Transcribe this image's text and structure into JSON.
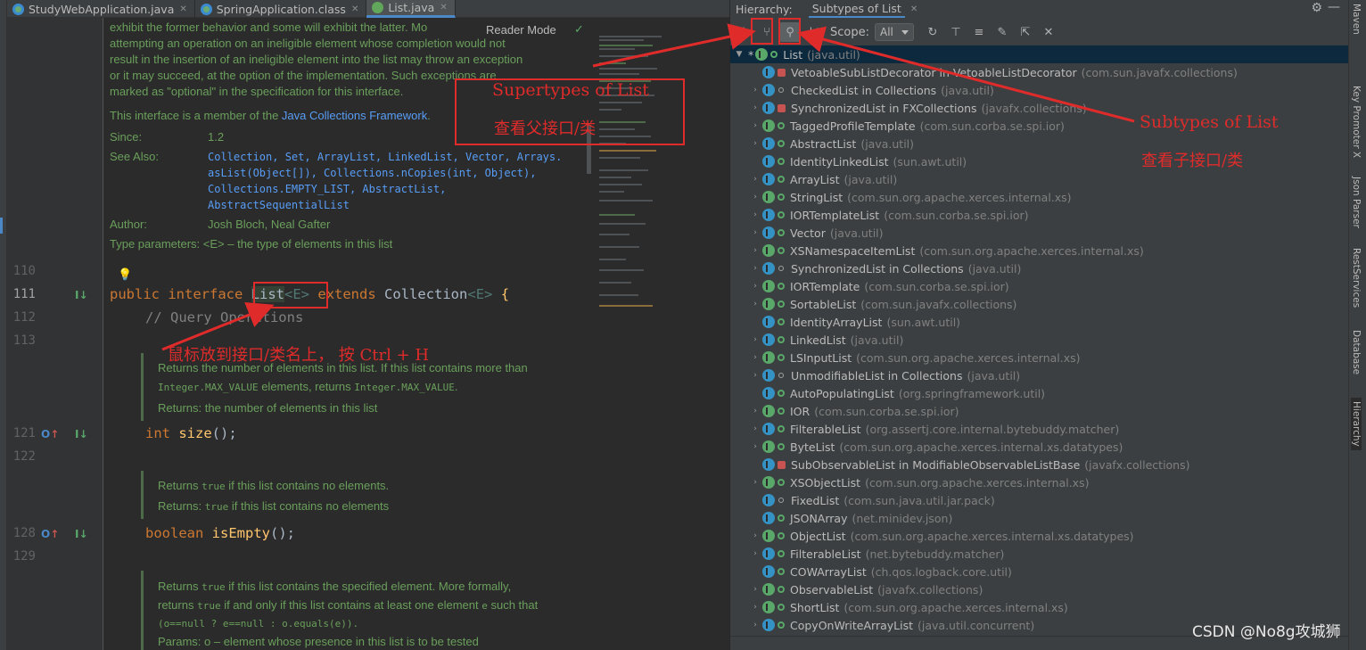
{
  "tabs": [
    {
      "label": "StudyWebApplication.java",
      "icon": "spring-boot-class-icon",
      "active": false
    },
    {
      "label": "SpringApplication.class",
      "icon": "spring-boot-class-icon",
      "active": false
    },
    {
      "label": "List.java",
      "icon": "interface-icon",
      "active": true
    }
  ],
  "editor": {
    "reader_mode": "Reader Mode",
    "doc_top": [
      "exhibit the former behavior and some will exhibit the latter. Mo",
      "attempting an operation on an ineligible element whose completion would not",
      "result in the insertion of an ineligible element into the list may throw an exception",
      "or it may succeed, at the option of the implementation. Such exceptions are",
      "marked as \"optional\" in the specification for this interface."
    ],
    "member_prefix": "This interface is a member of the ",
    "member_link": "Java Collections Framework",
    "member_suffix": ".",
    "since_label": "Since:",
    "since_value": "1.2",
    "see_also_label": "See Also:",
    "see_also_lines": [
      "Collection, Set, ArrayList, LinkedList, Vector, Arrays.",
      "asList(Object[]), Collections.nCopies(int, Object),",
      "Collections.EMPTY_LIST, AbstractList,",
      "AbstractSequentialList"
    ],
    "author_label": "Author:",
    "author_value": "Josh Bloch, Neal Gafter",
    "type_params": "Type parameters: <E> – the type of elements in this list",
    "line_numbers": {
      "l110": "110",
      "l111": "111",
      "l112": "112",
      "l113": "113",
      "l121": "121",
      "l122": "122",
      "l128": "128",
      "l129": "129"
    },
    "code_111": {
      "kw1": "public",
      "kw2": "interface",
      "name": "List",
      "gen": "<E>",
      "kw3": "extends",
      "parent": "Collection",
      "gen2": "<E>",
      "brace": "{"
    },
    "code_112": "// Query Operations",
    "doc_size": {
      "line1": "Returns the number of elements in this list. If this list contains more than",
      "line2a": "Integer.MAX_VALUE",
      "line2b": " elements, returns ",
      "line2c": "Integer.MAX_VALUE",
      "line2d": ".",
      "returns": "Returns: the number of elements in this list"
    },
    "code_121": {
      "kw": "int",
      "fn": "size",
      "rest": "();"
    },
    "doc_empty": {
      "line1a": "Returns ",
      "line1b": "true",
      "line1c": " if this list contains no elements.",
      "line2a": "Returns: ",
      "line2b": "true",
      "line2c": " if this list contains no elements"
    },
    "code_128": {
      "kw": "boolean",
      "fn": "isEmpty",
      "rest": "();"
    },
    "doc_contains": {
      "line1a": "Returns ",
      "line1b": "true",
      "line1c": " if this list contains the specified element. More formally,",
      "line2a": "returns ",
      "line2b": "true",
      "line2c": " if and only if this list contains at least one element ",
      "line2d": "e",
      "line2e": " such that",
      "line3": "(o==null  ?  e==null  :  o.equals(e)).",
      "line4": "Params:  o – element whose presence in this list is to be tested"
    }
  },
  "hierarchy": {
    "title": "Hierarchy:",
    "tab": "Subtypes of List",
    "scope_label": "Scope:",
    "scope_value": "All",
    "root": {
      "name": "List",
      "pkg": "(java.util)"
    },
    "items": [
      {
        "name": "VetoableSubListDecorator in VetoableListDecorator",
        "pkg": "(com.sun.javafx.collections)",
        "kind": "C",
        "vis": "priv",
        "expand": false
      },
      {
        "name": "CheckedList in Collections",
        "pkg": "(java.util)",
        "kind": "C",
        "vis": "pkg",
        "expand": true
      },
      {
        "name": "SynchronizedList in FXCollections",
        "pkg": "(javafx.collections)",
        "kind": "C",
        "vis": "priv",
        "expand": true
      },
      {
        "name": "TaggedProfileTemplate",
        "pkg": "(com.sun.corba.se.spi.ior)",
        "kind": "I",
        "vis": "pub",
        "expand": true
      },
      {
        "name": "AbstractList",
        "pkg": "(java.util)",
        "kind": "C",
        "vis": "pub",
        "expand": true
      },
      {
        "name": "IdentityLinkedList",
        "pkg": "(sun.awt.util)",
        "kind": "C",
        "vis": "pub",
        "expand": false
      },
      {
        "name": "ArrayList",
        "pkg": "(java.util)",
        "kind": "C",
        "vis": "pub",
        "expand": true
      },
      {
        "name": "StringList",
        "pkg": "(com.sun.org.apache.xerces.internal.xs)",
        "kind": "I",
        "vis": "pub",
        "expand": true
      },
      {
        "name": "IORTemplateList",
        "pkg": "(com.sun.corba.se.spi.ior)",
        "kind": "C",
        "vis": "pub",
        "expand": true
      },
      {
        "name": "Vector",
        "pkg": "(java.util)",
        "kind": "C",
        "vis": "pub",
        "expand": true
      },
      {
        "name": "XSNamespaceItemList",
        "pkg": "(com.sun.org.apache.xerces.internal.xs)",
        "kind": "I",
        "vis": "pub",
        "expand": true
      },
      {
        "name": "SynchronizedList in Collections",
        "pkg": "(java.util)",
        "kind": "C",
        "vis": "pkg",
        "expand": true
      },
      {
        "name": "IORTemplate",
        "pkg": "(com.sun.corba.se.spi.ior)",
        "kind": "I",
        "vis": "pub",
        "expand": true
      },
      {
        "name": "SortableList",
        "pkg": "(com.sun.javafx.collections)",
        "kind": "I",
        "vis": "pub",
        "expand": true
      },
      {
        "name": "IdentityArrayList",
        "pkg": "(sun.awt.util)",
        "kind": "C",
        "vis": "pub",
        "expand": false
      },
      {
        "name": "LinkedList",
        "pkg": "(java.util)",
        "kind": "C",
        "vis": "pub",
        "expand": true
      },
      {
        "name": "LSInputList",
        "pkg": "(com.sun.org.apache.xerces.internal.xs)",
        "kind": "I",
        "vis": "pub",
        "expand": true
      },
      {
        "name": "UnmodifiableList in Collections",
        "pkg": "(java.util)",
        "kind": "C",
        "vis": "pkg",
        "expand": true
      },
      {
        "name": "AutoPopulatingList",
        "pkg": "(org.springframework.util)",
        "kind": "C",
        "vis": "pub",
        "expand": false
      },
      {
        "name": "IOR",
        "pkg": "(com.sun.corba.se.spi.ior)",
        "kind": "I",
        "vis": "pub",
        "expand": true
      },
      {
        "name": "FilterableList",
        "pkg": "(org.assertj.core.internal.bytebuddy.matcher)",
        "kind": "C",
        "vis": "pub",
        "expand": true
      },
      {
        "name": "ByteList",
        "pkg": "(com.sun.org.apache.xerces.internal.xs.datatypes)",
        "kind": "I",
        "vis": "pub",
        "expand": true
      },
      {
        "name": "SubObservableList in ModifiableObservableListBase",
        "pkg": "(javafx.collections)",
        "kind": "C",
        "vis": "priv",
        "expand": false
      },
      {
        "name": "XSObjectList",
        "pkg": "(com.sun.org.apache.xerces.internal.xs)",
        "kind": "I",
        "vis": "pub",
        "expand": true
      },
      {
        "name": "FixedList",
        "pkg": "(com.sun.java.util.jar.pack)",
        "kind": "C",
        "vis": "pkg",
        "expand": false
      },
      {
        "name": "JSONArray",
        "pkg": "(net.minidev.json)",
        "kind": "C",
        "vis": "pub",
        "expand": false
      },
      {
        "name": "ObjectList",
        "pkg": "(com.sun.org.apache.xerces.internal.xs.datatypes)",
        "kind": "I",
        "vis": "pub",
        "expand": true
      },
      {
        "name": "FilterableList",
        "pkg": "(net.bytebuddy.matcher)",
        "kind": "C",
        "vis": "pub",
        "expand": true
      },
      {
        "name": "COWArrayList",
        "pkg": "(ch.qos.logback.core.util)",
        "kind": "C",
        "vis": "pub",
        "expand": false
      },
      {
        "name": "ObservableList",
        "pkg": "(javafx.collections)",
        "kind": "I",
        "vis": "pub",
        "expand": true
      },
      {
        "name": "ShortList",
        "pkg": "(com.sun.org.apache.xerces.internal.xs)",
        "kind": "I",
        "vis": "pub",
        "expand": true
      },
      {
        "name": "CopyOnWriteArrayList",
        "pkg": "(java.util.concurrent)",
        "kind": "C",
        "vis": "pub",
        "expand": true
      }
    ]
  },
  "sidebar": [
    "Maven",
    "Key Promoter X",
    "Json Parser",
    "RestServices",
    "Database",
    "Hierarchy"
  ],
  "annotations": {
    "supertypes_en": "Supertypes of List",
    "supertypes_cn": "查看父接口/类",
    "subtypes_en": "Subtypes of List",
    "subtypes_cn": "查看子接口/类",
    "hint": "鼠标放到接口/类名上，  按 Ctrl + H"
  },
  "watermark": "CSDN @No8g攻城狮",
  "colors": {
    "annotation": "#e02b2b",
    "accent": "#4a88c7",
    "interface": "#59a869",
    "class": "#3592c4"
  }
}
